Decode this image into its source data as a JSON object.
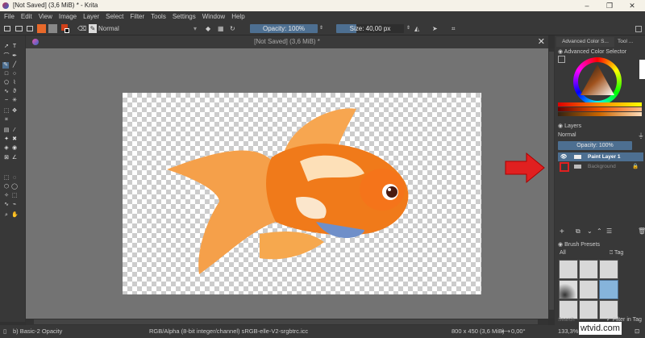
{
  "window": {
    "title": "[Not Saved]  (3,6 MiB) * - Krita",
    "minimize": "–",
    "maximize": "❐",
    "close": "✕"
  },
  "menu": [
    "File",
    "Edit",
    "View",
    "Image",
    "Layer",
    "Select",
    "Filter",
    "Tools",
    "Settings",
    "Window",
    "Help"
  ],
  "toolbar": {
    "blend_mode": "Normal",
    "opacity": "Opacity: 100%",
    "size": "Size: 40,00 px"
  },
  "document": {
    "tab_title": "[Not Saved]  (3,6 MiB) *",
    "close": "✕"
  },
  "dock": {
    "tabs": [
      "Advanced Color S...",
      "Tool ..."
    ],
    "color_selector_title": "Advanced Color Selector",
    "layers_title": "Layers",
    "layers_blend": "Normal",
    "layers_opacity": "Opacity:  100%",
    "layers": [
      {
        "name": "Paint Layer 1",
        "selected": true
      },
      {
        "name": "Background",
        "selected": false
      }
    ],
    "brush_presets_title": "Brush Presets",
    "brush_filter": "All",
    "tag_label": "Tag",
    "search_placeholder": "Search",
    "filter_in_tag": "Filter in Tag"
  },
  "status": {
    "brush": "b) Basic-2 Opacity",
    "color_space": "RGB/Alpha (8-bit integer/channel)  sRGB-elle-V2-srgbtrc.icc",
    "image_size": "800 x 450 (3,6 MiB)",
    "rotation": "0,00°",
    "zoom": "133,3%"
  },
  "watermark": "wtvid.com",
  "colors": {
    "accent": "#4d6f91",
    "highlight_red": "#e02020"
  }
}
